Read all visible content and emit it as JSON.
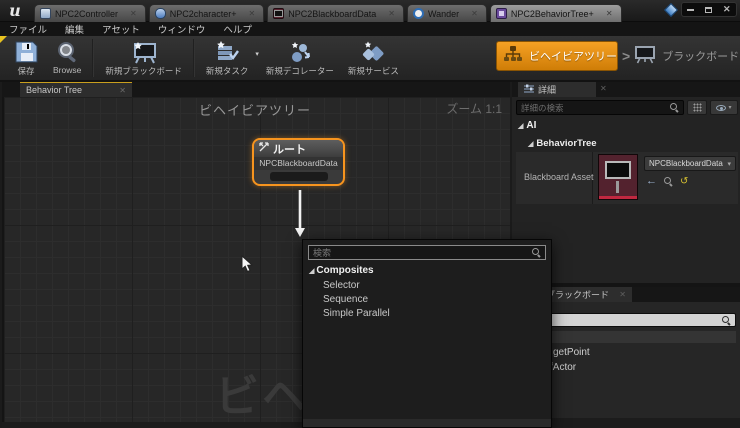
{
  "window": {
    "tabs": [
      {
        "label": "NPC2Controller"
      },
      {
        "label": "NPC2character+"
      },
      {
        "label": "NPC2BlackboardData"
      },
      {
        "label": "Wander"
      },
      {
        "label": "NPC2BehaviorTree+"
      }
    ]
  },
  "menubar": {
    "items": [
      "ファイル",
      "編集",
      "アセット",
      "ウィンドウ",
      "ヘルプ"
    ]
  },
  "toolbar": {
    "buttons": [
      {
        "label": "保存"
      },
      {
        "label": "Browse"
      },
      {
        "label": "新規ブラックボード"
      },
      {
        "label": "新規タスク"
      },
      {
        "label": "新規デコレーター"
      },
      {
        "label": "新規サービス"
      }
    ],
    "mode_switch": {
      "active": "ビヘイビアツリー",
      "separator": ">",
      "inactive": "ブラックボード"
    }
  },
  "graph": {
    "tab": "Behavior Tree",
    "title": "ビヘイビアツリー",
    "zoom_label": "ズーム 1:1",
    "watermark": "ビヘイビアツリー",
    "node": {
      "title": "ルート",
      "subtitle": "NPCBlackboardData"
    }
  },
  "context_menu": {
    "search_placeholder": "検索",
    "category": "Composites",
    "items": [
      "Selector",
      "Sequence",
      "Simple Parallel"
    ]
  },
  "details": {
    "tab": "詳細",
    "search_placeholder": "詳細の検索",
    "category": "AI",
    "subcategory": "BehaviorTree",
    "row_label": "Blackboard Asset",
    "asset_value": "NPCBlackboardData"
  },
  "blackboard_panel": {
    "tab": "ブラックボード",
    "entries": [
      "getPoint",
      "fActor"
    ]
  },
  "icons": {
    "close": "✕",
    "caret": "▾",
    "triangle": "◢",
    "back": "←",
    "reset": "↺"
  },
  "colors": {
    "accent_orange": "#f7941e",
    "selection_orange": "#f6a124",
    "tab_yellow": "#c99f1e",
    "asset_maroon": "#53222e",
    "grid_bg": "#272727"
  }
}
